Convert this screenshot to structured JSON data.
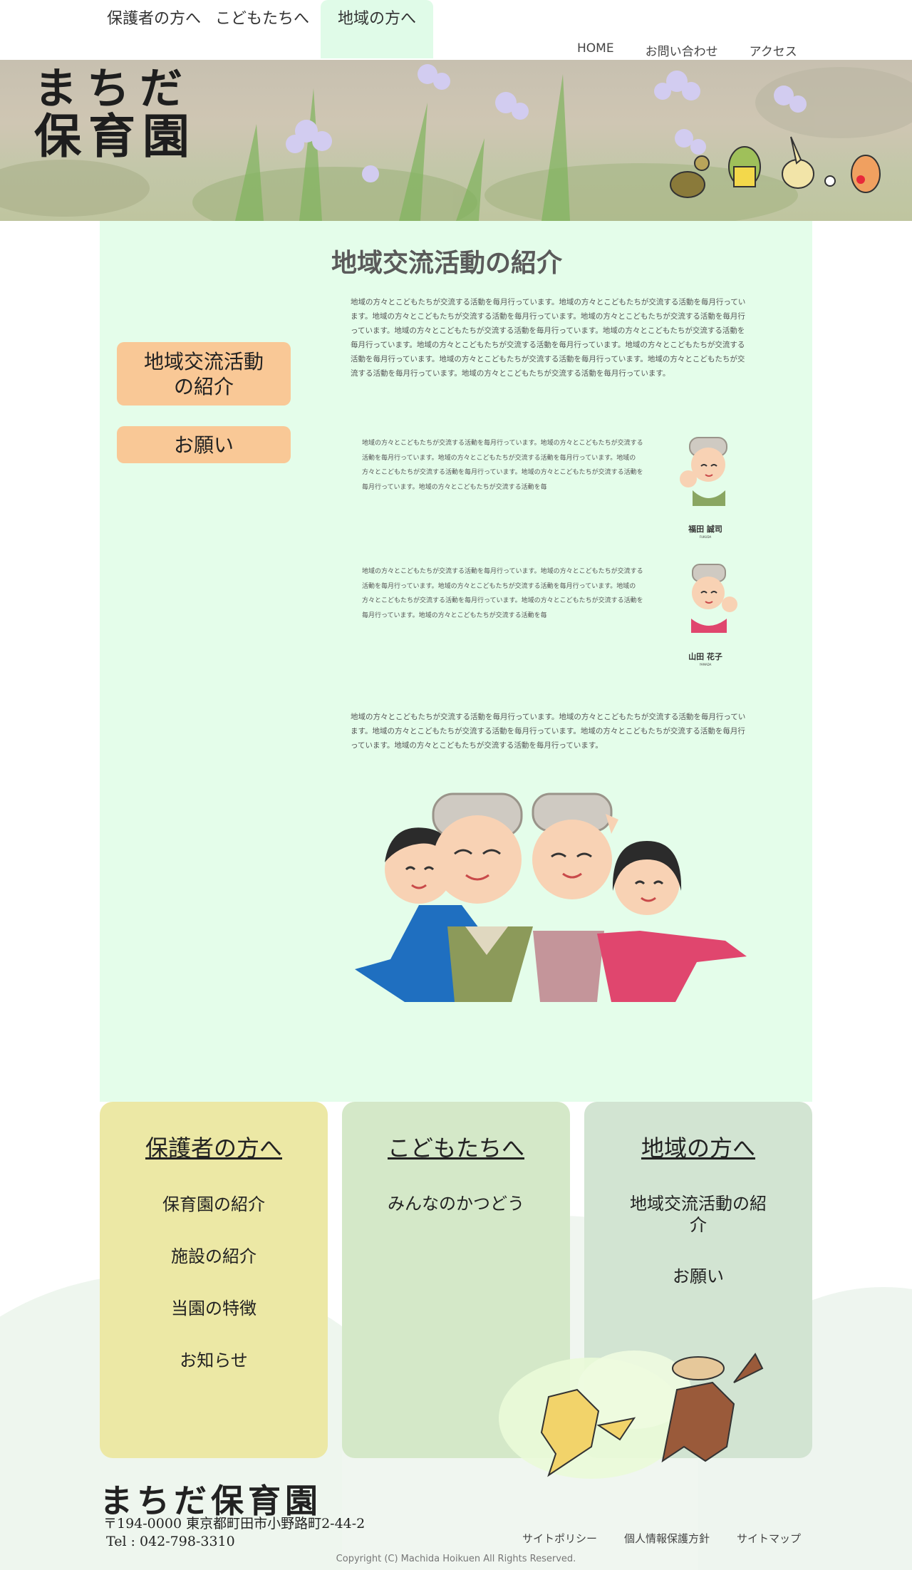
{
  "header": {
    "audience_tabs": [
      {
        "label": "保護者の方へ"
      },
      {
        "label": "こどもたちへ"
      },
      {
        "label": "地域の方へ"
      }
    ],
    "active_tab": "地域の方へ",
    "util_links": [
      {
        "label": "HOME"
      },
      {
        "label": "お問い合わせ"
      },
      {
        "label": "アクセス"
      }
    ],
    "logo_line1": "まちだ",
    "logo_line2": "保育園"
  },
  "main": {
    "title": "地域交流活動の紹介",
    "side_buttons": [
      {
        "label": "地域交流活動の紹介"
      },
      {
        "label": "お願い"
      }
    ],
    "intro_text": "地域の方々とこどもたちが交流する活動を毎月行っています。地域の方々とこどもたちが交流する活動を毎月行っています。地域の方々とこどもたちが交流する活動を毎月行っています。地域の方々とこどもたちが交流する活動を毎月行っています。地域の方々とこどもたちが交流する活動を毎月行っています。地域の方々とこどもたちが交流する活動を毎月行っています。地域の方々とこどもたちが交流する活動を毎月行っています。地域の方々とこどもたちが交流する活動を毎月行っています。地域の方々とこどもたちが交流する活動を毎月行っています。地域の方々とこどもたちが交流する活動を毎月行っています。地域の方々とこどもたちが交流する活動を毎月行っています。",
    "persons": [
      {
        "text": "地域の方々とこどもたちが交流する活動を毎月行っています。地域の方々とこどもたちが交流する活動を毎月行っています。地域の方々とこどもたちが交流する活動を毎月行っています。地域の方々とこどもたちが交流する活動を毎月行っています。地域の方々とこどもたちが交流する活動を毎月行っています。地域の方々とこどもたちが交流する活動を毎",
        "name": "福田 誠司",
        "sub": "FUKUDA"
      },
      {
        "text": "地域の方々とこどもたちが交流する活動を毎月行っています。地域の方々とこどもたちが交流する活動を毎月行っています。地域の方々とこどもたちが交流する活動を毎月行っています。地域の方々とこどもたちが交流する活動を毎月行っています。地域の方々とこどもたちが交流する活動を毎月行っています。地域の方々とこどもたちが交流する活動を毎",
        "name": "山田 花子",
        "sub": "YAMADA"
      }
    ],
    "outro_text": "地域の方々とこどもたちが交流する活動を毎月行っています。地域の方々とこどもたちが交流する活動を毎月行っています。地域の方々とこどもたちが交流する活動を毎月行っています。地域の方々とこどもたちが交流する活動を毎月行っています。地域の方々とこどもたちが交流する活動を毎月行っています。"
  },
  "footer_nav": [
    {
      "title": "保護者の方へ",
      "items": [
        "保育園の紹介",
        "施設の紹介",
        "当園の特徴",
        "お知らせ"
      ]
    },
    {
      "title": "こどもたちへ",
      "items": [
        "みんなのかつどう"
      ]
    },
    {
      "title": "地域の方へ",
      "items": [
        "地域交流活動の紹介",
        "お願い"
      ]
    }
  ],
  "footer": {
    "logo": "まちだ保育園",
    "address": "〒194-0000 東京都町田市小野路町2-44-2",
    "tel": "Tel : 042-798-3310",
    "links": [
      {
        "label": "サイトポリシー"
      },
      {
        "label": "個人情報保護方針"
      },
      {
        "label": "サイトマップ"
      }
    ],
    "copyright": "Copyright (C) Machida Hoikuen All Rights Reserved."
  },
  "colors": {
    "main_bg": "#e4fdea",
    "side_button": "#f9c896",
    "card_parents": "#ece8a5",
    "card_children": "#d4e8c8",
    "card_community": "#d2e4d2"
  },
  "icons": [
    "flower-banner-illustration",
    "animal-characters-illustration",
    "elderly-man-avatar",
    "elderly-woman-avatar",
    "family-illustration",
    "fox-monkey-illustration"
  ]
}
